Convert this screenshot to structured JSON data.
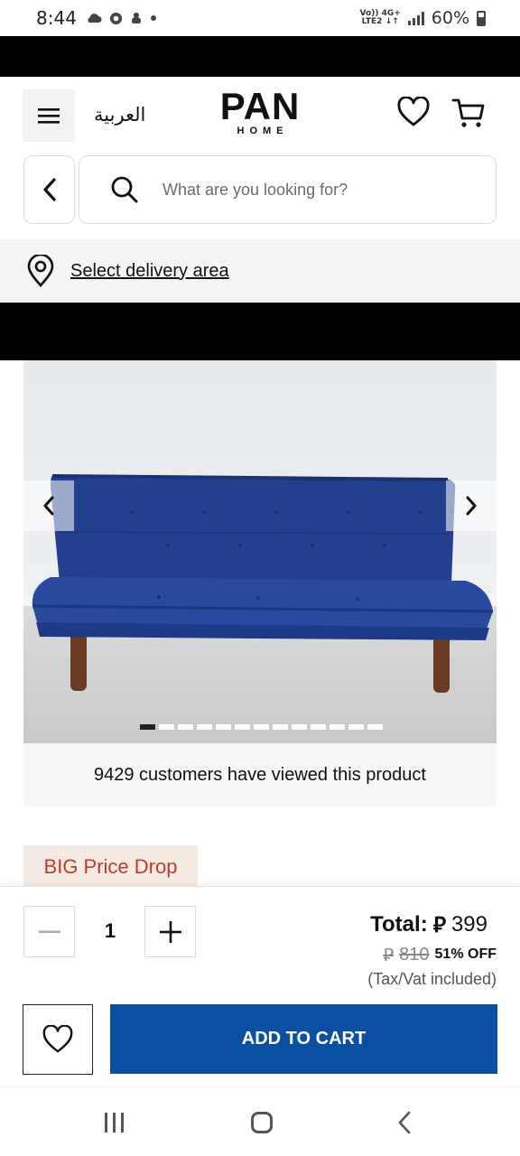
{
  "status_bar": {
    "time": "8:44",
    "left_icons": [
      "cloud-icon",
      "chrome-icon",
      "app-icon",
      "dot-icon"
    ],
    "network_label_top": "Vo)) 4G+",
    "network_label_bottom": "LTE2 ↓↑",
    "battery": "60%"
  },
  "header": {
    "language_link": "العربية",
    "logo_main": "PAN",
    "logo_sub": "HOME"
  },
  "search": {
    "placeholder": "What are you looking for?"
  },
  "delivery": {
    "label": "Select delivery area"
  },
  "gallery": {
    "image_count": 13,
    "active_index": 0
  },
  "viewers_text": "9429 customers have viewed this product",
  "badge": "BIG Price Drop",
  "purchase": {
    "quantity": "1",
    "total_label": "Total:",
    "currency_symbol": "⃁",
    "price": "399",
    "old_price": "810",
    "discount": "51% OFF",
    "tax_note": "(Tax/Vat included)",
    "add_to_cart": "ADD TO CART"
  },
  "colors": {
    "primary_button": "#0b4fa3",
    "badge_text": "#c0392b",
    "badge_bg": "#f5ebe3",
    "sofa": "#1f3f8f"
  },
  "nav_bar": {
    "icons": [
      "recent-apps-icon",
      "home-icon",
      "back-icon"
    ]
  }
}
